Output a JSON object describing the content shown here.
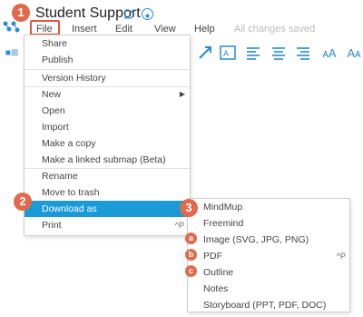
{
  "app": {
    "doc_title": "Student Support",
    "saved_status": "All changes saved"
  },
  "menubar": [
    "File",
    "Insert",
    "Edit",
    "View",
    "Help"
  ],
  "file_menu": {
    "items": [
      {
        "label": "Share"
      },
      {
        "label": "Publish"
      },
      {
        "label": "Version History"
      },
      {
        "label": "New",
        "submenu": true
      },
      {
        "label": "Open"
      },
      {
        "label": "Import"
      },
      {
        "label": "Make a copy"
      },
      {
        "label": "Make a linked submap (Beta)"
      },
      {
        "label": "Rename"
      },
      {
        "label": "Move to trash"
      },
      {
        "label": "Download as",
        "highlighted": true
      },
      {
        "label": "Print",
        "shortcut": "^P"
      }
    ]
  },
  "download_menu": {
    "items": [
      {
        "label": "MindMup"
      },
      {
        "label": "Freemind"
      },
      {
        "label": "Image (SVG, JPG, PNG)"
      },
      {
        "label": "PDF",
        "shortcut": "^P"
      },
      {
        "label": "Outline"
      },
      {
        "label": "Notes"
      },
      {
        "label": "Storyboard (PPT, PDF, DOC)"
      }
    ]
  },
  "annotations": {
    "step1": "1",
    "step2": "2",
    "step3": "3",
    "a": "a",
    "b": "b",
    "c": "c"
  },
  "toolbar_icons": [
    "connect-arrow-icon",
    "image-icon",
    "align-left-icon",
    "align-center-icon",
    "align-right-icon",
    "increase-font-icon",
    "decrease-font-icon"
  ],
  "colors": {
    "highlight": "#1a9bd7",
    "annotation": "#e06a4c",
    "icon_blue": "#2a8bd6"
  }
}
